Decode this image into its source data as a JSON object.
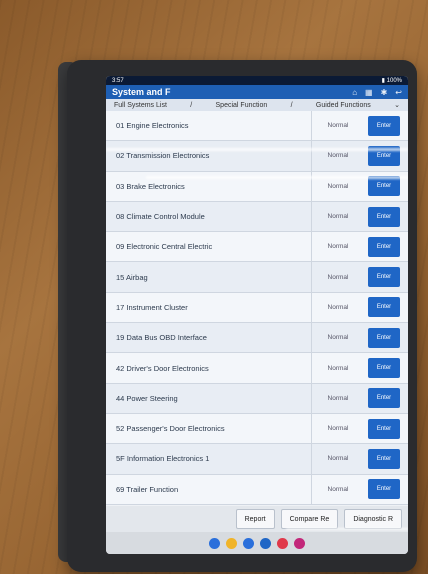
{
  "status_bar": {
    "time": "3:57",
    "battery": "▮ 100%"
  },
  "header": {
    "title": "System and F"
  },
  "tabs": [
    {
      "label": "Full Systems List"
    },
    {
      "label": "Special Function"
    },
    {
      "label": "Guided Functions"
    }
  ],
  "systems": [
    {
      "name": "01 Engine Electronics",
      "status": "Normal",
      "action": "Enter"
    },
    {
      "name": "02 Transmission Electronics",
      "status": "Normal",
      "action": "Enter"
    },
    {
      "name": "03 Brake Electronics",
      "status": "Normal",
      "action": "Enter"
    },
    {
      "name": "08 Climate Control Module",
      "status": "Normal",
      "action": "Enter"
    },
    {
      "name": "09 Electronic Central Electric",
      "status": "Normal",
      "action": "Enter"
    },
    {
      "name": "15 Airbag",
      "status": "Normal",
      "action": "Enter"
    },
    {
      "name": "17 Instrument Cluster",
      "status": "Normal",
      "action": "Enter"
    },
    {
      "name": "19 Data Bus OBD Interface",
      "status": "Normal",
      "action": "Enter"
    },
    {
      "name": "42 Driver's Door Electronics",
      "status": "Normal",
      "action": "Enter"
    },
    {
      "name": "44 Power Steering",
      "status": "Normal",
      "action": "Enter"
    },
    {
      "name": "52 Passenger's Door Electronics",
      "status": "Normal",
      "action": "Enter"
    },
    {
      "name": "5F Information Electronics 1",
      "status": "Normal",
      "action": "Enter"
    },
    {
      "name": "69 Trailer Function",
      "status": "Normal",
      "action": "Enter"
    }
  ],
  "bottom_buttons": {
    "report": "Report",
    "compare": "Compare Re",
    "diagnostic": "Diagnostic R"
  },
  "dock_colors": [
    "#2a6fdb",
    "#f0b429",
    "#2a6fdb",
    "#1f66c6",
    "#e0394a",
    "#c2277a"
  ]
}
